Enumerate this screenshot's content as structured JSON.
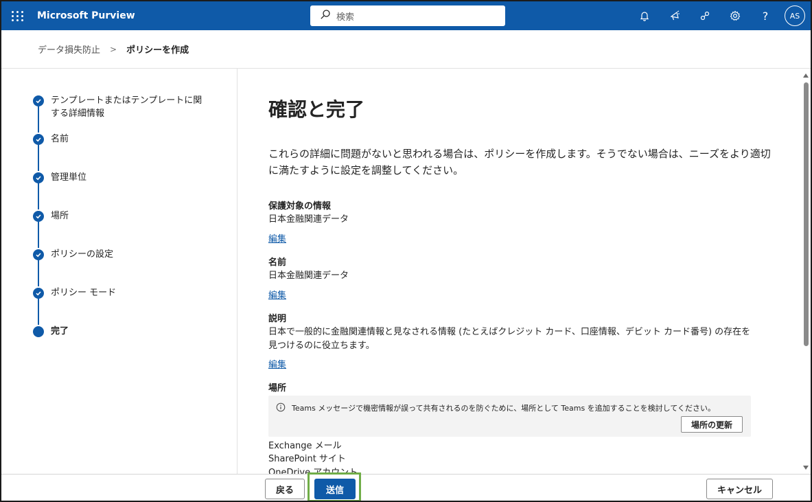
{
  "app": {
    "title": "Microsoft Purview"
  },
  "search": {
    "placeholder": "検索"
  },
  "topbar_icons": [
    "bell-icon",
    "megaphone-icon",
    "share-icon",
    "gear-icon",
    "help-icon"
  ],
  "help_glyph": "?",
  "user": {
    "initials": "AS"
  },
  "breadcrumb": {
    "parent": "データ損失防止",
    "separator": ">",
    "current": "ポリシーを作成"
  },
  "steps": [
    {
      "label": "テンプレートまたはテンプレートに関する詳細情報",
      "state": "done"
    },
    {
      "label": "名前",
      "state": "done"
    },
    {
      "label": "管理単位",
      "state": "done"
    },
    {
      "label": "場所",
      "state": "done"
    },
    {
      "label": "ポリシーの設定",
      "state": "done"
    },
    {
      "label": "ポリシー モード",
      "state": "done"
    },
    {
      "label": "完了",
      "state": "current"
    }
  ],
  "main": {
    "title": "確認と完了",
    "intro": "これらの詳細に問題がないと思われる場合は、ポリシーを作成します。そうでない場合は、ニーズをより適切に満たすように設定を調整してください。",
    "sections": {
      "protected_info": {
        "title": "保護対象の情報",
        "value": "日本金融関連データ",
        "edit": "編集"
      },
      "name": {
        "title": "名前",
        "value": "日本金融関連データ",
        "edit": "編集"
      },
      "description": {
        "title": "説明",
        "value": "日本で一般的に金融関連情報と見なされる情報 (たとえばクレジット カード、口座情報、デビット カード番号) の存在を見つけるのに役立ちます。",
        "edit": "編集"
      },
      "locations": {
        "title": "場所",
        "notice": "Teams メッセージで機密情報が誤って共有されるのを防ぐために、場所として Teams を追加することを検討してください。",
        "notice_button": "場所の更新",
        "items": [
          "Exchange メール",
          "SharePoint サイト",
          "OneDrive アカウント"
        ]
      }
    }
  },
  "footer": {
    "back": "戻る",
    "submit": "送信",
    "cancel": "キャンセル"
  },
  "colors": {
    "brand": "#0f5aa8",
    "highlight": "#70ad47"
  }
}
